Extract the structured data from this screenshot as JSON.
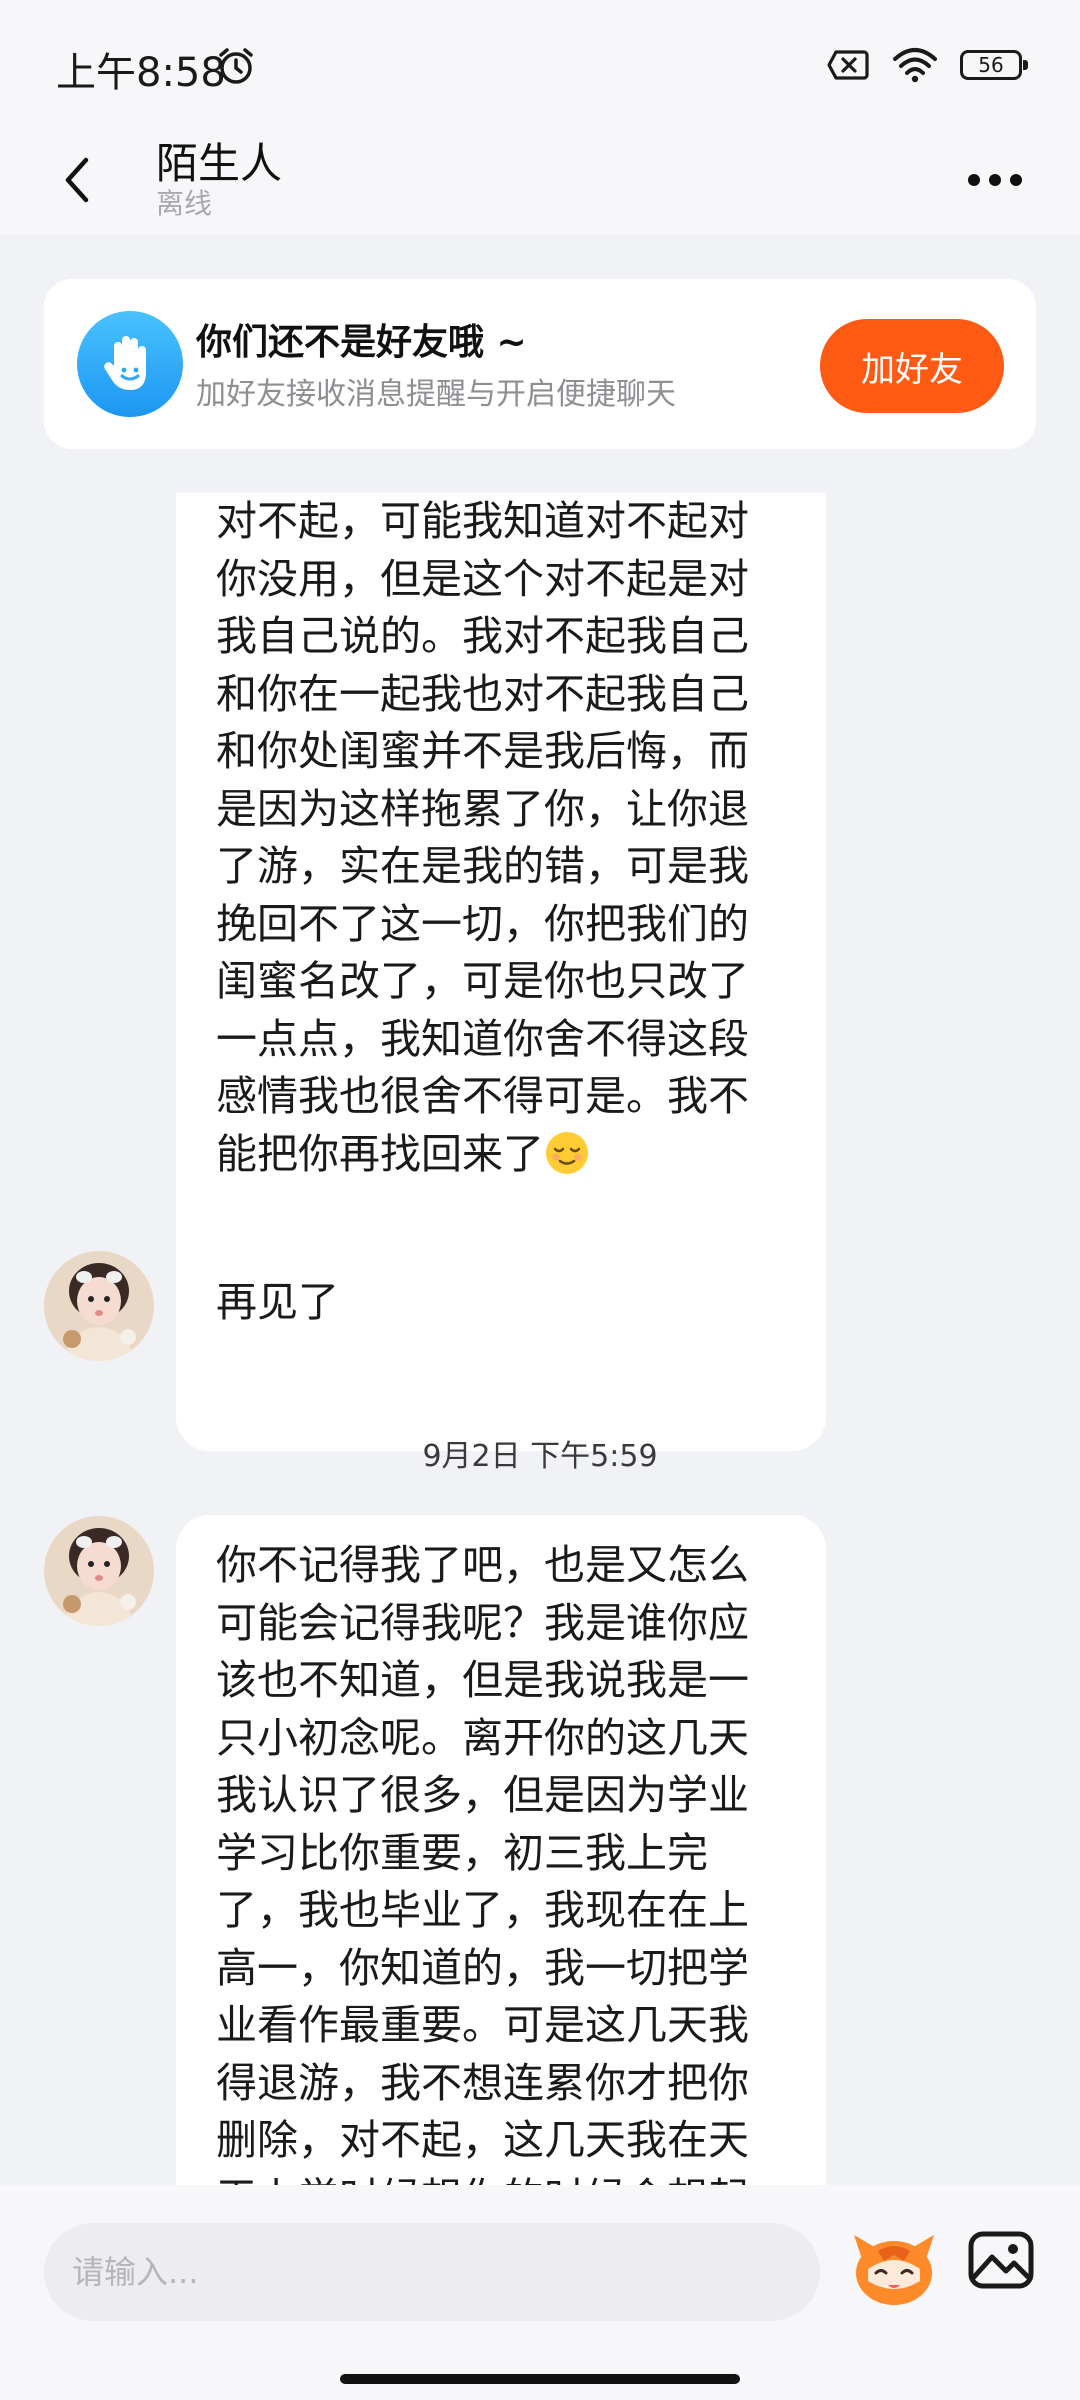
{
  "status_bar": {
    "time": "上午8:58",
    "battery": "56"
  },
  "header": {
    "title": "陌生人",
    "subtitle": "离线"
  },
  "friend_card": {
    "title": "你们还不是好友哦 ~",
    "description": "加好友接收消息提醒与开启便捷聊天",
    "button_label": "加好友"
  },
  "messages": [
    {
      "lines": [
        "对不起，可能我知道对不起对",
        "你没用，但是这个对不起是对",
        "我自己说的。我对不起我自己",
        "和你在一起我也对不起我自己",
        "和你处闺蜜并不是我后悔，而",
        "是因为这样拖累了你，让你退",
        "了游，实在是我的错，可是我",
        "挽回不了这一切，你把我们的",
        "闺蜜名改了，可是你也只改了",
        "一点点，我知道你舍不得这段",
        "感情我也很舍不得可是。我不",
        "能把你再找回来了"
      ]
    },
    {
      "text": "再见了"
    },
    {
      "lines": [
        "你不记得我了吧，也是又怎么",
        "可能会记得我呢？我是谁你应",
        "该也不知道，但是我说我是一",
        "只小初念呢。离开你的这几天",
        "我认识了很多，但是因为学业",
        "学习比你重要，初三我上完",
        "了，我也毕业了，我现在在上",
        "高一，你知道的，我一切把学",
        "业看作最重要。可是这几天我",
        "得退游，我不想连累你才把你",
        "删除，对不起，这几天我在天",
        "天上学时候想你的时候会想起"
      ]
    }
  ],
  "timestamp": "9月2日 下午5:59",
  "input": {
    "placeholder": "请输入..."
  },
  "icons": {
    "status": [
      "alarm-icon",
      "no-sim-icon",
      "wifi-icon",
      "battery-icon"
    ],
    "header": [
      "back-arrow-icon",
      "more-dots-icon"
    ],
    "card": [
      "hand-icon"
    ],
    "input": [
      "mascot-icon",
      "image-icon"
    ]
  },
  "colors": {
    "accent": "#ff5a14",
    "card_icon": "#2ea7f7",
    "background": "#f1f2f5"
  }
}
